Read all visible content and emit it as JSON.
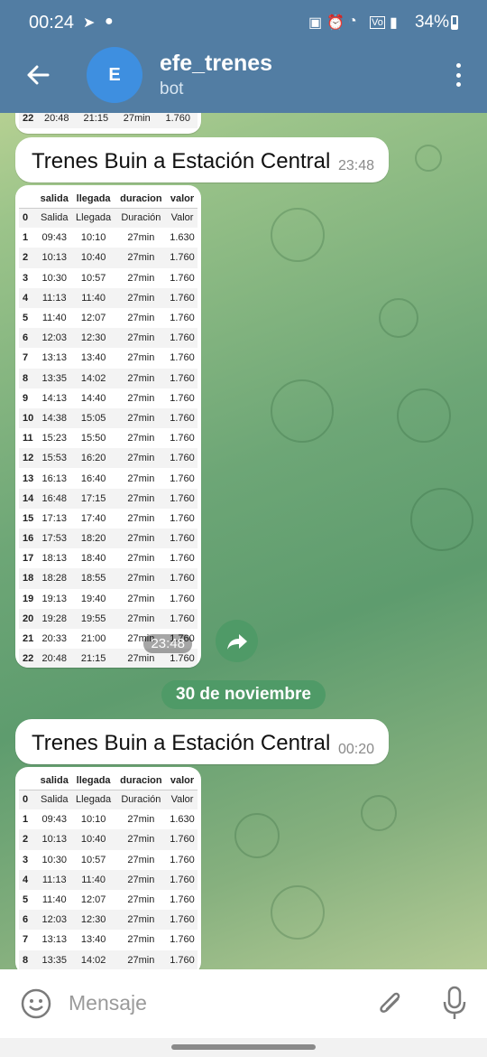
{
  "status_bar": {
    "time": "00:24",
    "battery": "34%",
    "icons": [
      "telegram-icon",
      "chat-bubble-icon",
      "nfc-icon",
      "alarm-icon",
      "wifi-icon",
      "volte-icon",
      "signal-icon",
      "battery-icon"
    ]
  },
  "header": {
    "avatar_letter": "E",
    "avatar_color": "#3e8fe0",
    "title": "efe_trenes",
    "subtitle": "bot",
    "bar_color": "#527da3"
  },
  "top_partial_row": [
    "22",
    "20:48",
    "21:15",
    "27min",
    "1.760"
  ],
  "messages": [
    {
      "text": "Trenes Buin a Estación Central",
      "time": "23:48"
    },
    {
      "text": "Trenes Buin a Estación Central",
      "time": "00:20"
    }
  ],
  "table": {
    "headers": [
      "",
      "salida",
      "llegada",
      "duracion",
      "valor"
    ],
    "rows": [
      [
        "0",
        "Salida",
        "Llegada",
        "Duración",
        "Valor"
      ],
      [
        "1",
        "09:43",
        "10:10",
        "27min",
        "1.630"
      ],
      [
        "2",
        "10:13",
        "10:40",
        "27min",
        "1.760"
      ],
      [
        "3",
        "10:30",
        "10:57",
        "27min",
        "1.760"
      ],
      [
        "4",
        "11:13",
        "11:40",
        "27min",
        "1.760"
      ],
      [
        "5",
        "11:40",
        "12:07",
        "27min",
        "1.760"
      ],
      [
        "6",
        "12:03",
        "12:30",
        "27min",
        "1.760"
      ],
      [
        "7",
        "13:13",
        "13:40",
        "27min",
        "1.760"
      ],
      [
        "8",
        "13:35",
        "14:02",
        "27min",
        "1.760"
      ],
      [
        "9",
        "14:13",
        "14:40",
        "27min",
        "1.760"
      ],
      [
        "10",
        "14:38",
        "15:05",
        "27min",
        "1.760"
      ],
      [
        "11",
        "15:23",
        "15:50",
        "27min",
        "1.760"
      ],
      [
        "12",
        "15:53",
        "16:20",
        "27min",
        "1.760"
      ],
      [
        "13",
        "16:13",
        "16:40",
        "27min",
        "1.760"
      ],
      [
        "14",
        "16:48",
        "17:15",
        "27min",
        "1.760"
      ],
      [
        "15",
        "17:13",
        "17:40",
        "27min",
        "1.760"
      ],
      [
        "16",
        "17:53",
        "18:20",
        "27min",
        "1.760"
      ],
      [
        "17",
        "18:13",
        "18:40",
        "27min",
        "1.760"
      ],
      [
        "18",
        "18:28",
        "18:55",
        "27min",
        "1.760"
      ],
      [
        "19",
        "19:13",
        "19:40",
        "27min",
        "1.760"
      ],
      [
        "20",
        "19:28",
        "19:55",
        "27min",
        "1.760"
      ],
      [
        "21",
        "20:33",
        "21:00",
        "27min",
        "1.760"
      ],
      [
        "22",
        "20:48",
        "21:15",
        "27min",
        "1.760"
      ]
    ],
    "photo_time": "23:48"
  },
  "date_separator": "30 de noviembre",
  "input": {
    "placeholder": "Mensaje"
  },
  "colors": {
    "accent_green": "#4f9a67"
  }
}
